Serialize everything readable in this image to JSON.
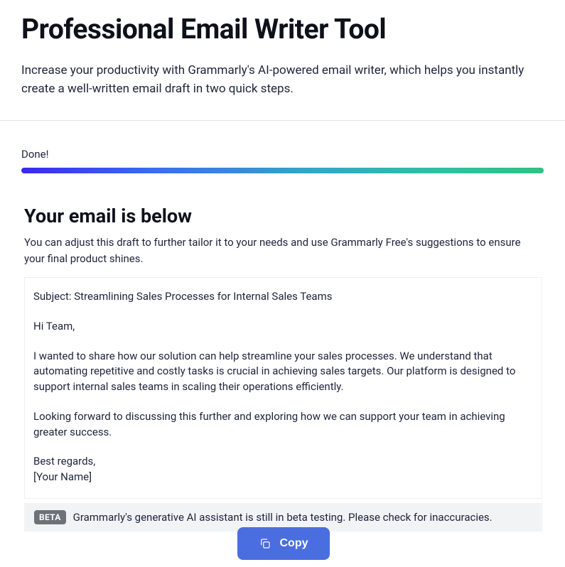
{
  "header": {
    "title": "Professional Email Writer Tool",
    "subtitle": "Increase your productivity with Grammarly's AI-powered email writer, which helps you instantly create a well-written email draft in two quick steps."
  },
  "status": {
    "label": "Done!"
  },
  "result": {
    "title": "Your email is below",
    "subtitle": "You can adjust this draft to further tailor it to your needs and use Grammarly Free's suggestions to ensure your final product shines.",
    "email": {
      "subject_line": "Subject: Streamlining Sales Processes for Internal Sales Teams",
      "greeting": "Hi Team,",
      "body1": "I wanted to share how our solution can help streamline your sales processes. We understand that automating repetitive and costly tasks is crucial in achieving sales targets. Our platform is designed to support internal sales teams in scaling their operations efficiently.",
      "body2": "Looking forward to discussing this further and exploring how we can support your team in achieving greater success.",
      "signoff": "Best regards,",
      "signature": "[Your Name]"
    }
  },
  "beta": {
    "badge": "BETA",
    "text": "Grammarly's generative AI assistant is still in beta testing. Please check for inaccuracies."
  },
  "actions": {
    "copy_label": "Copy"
  }
}
